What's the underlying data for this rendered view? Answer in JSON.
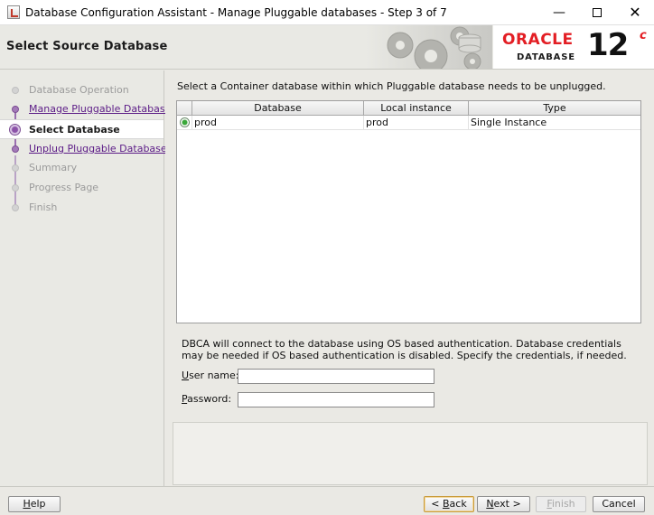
{
  "window": {
    "title": "Database Configuration Assistant - Manage Pluggable databases - Step 3 of 7"
  },
  "header": {
    "page_title": "Select Source Database",
    "logo_word": "ORACLE",
    "logo_sub": "DATABASE",
    "version": "12",
    "version_suffix": "c"
  },
  "steps": [
    {
      "label": "Database Operation",
      "state": "disabled"
    },
    {
      "label": "Manage Pluggable Databases",
      "state": "done"
    },
    {
      "label": "Select Database",
      "state": "current"
    },
    {
      "label": "Unplug Pluggable Database",
      "state": "done"
    },
    {
      "label": "Summary",
      "state": "disabled"
    },
    {
      "label": "Progress Page",
      "state": "disabled"
    },
    {
      "label": "Finish",
      "state": "disabled"
    }
  ],
  "main": {
    "instruction": "Select a Container database within which Pluggable database needs to be unplugged.",
    "table": {
      "headers": {
        "database": "Database",
        "local_instance": "Local instance",
        "type": "Type"
      },
      "rows": [
        {
          "selected": true,
          "database": "prod",
          "local_instance": "prod",
          "type": "Single Instance"
        }
      ]
    },
    "auth_note": "DBCA will connect to the database using OS based authentication. Database credentials may be needed if OS based authentication is disabled. Specify the credentials, if needed.",
    "username_label_mnemonic": "U",
    "username_label_rest": "ser name:",
    "password_label_mnemonic": "P",
    "password_label_rest": "assword:",
    "username_value": "",
    "password_value": ""
  },
  "buttons": {
    "help_mnemonic": "H",
    "help_rest": "elp",
    "back_prefix": "< ",
    "back_mnemonic": "B",
    "back_rest": "ack",
    "next_mnemonic": "N",
    "next_rest": "ext >",
    "finish_mnemonic": "F",
    "finish_rest": "inish",
    "cancel": "Cancel"
  },
  "colors": {
    "oracle_red": "#e31e24",
    "step_purple": "#5b1b86",
    "radio_green": "#3aa83a"
  }
}
